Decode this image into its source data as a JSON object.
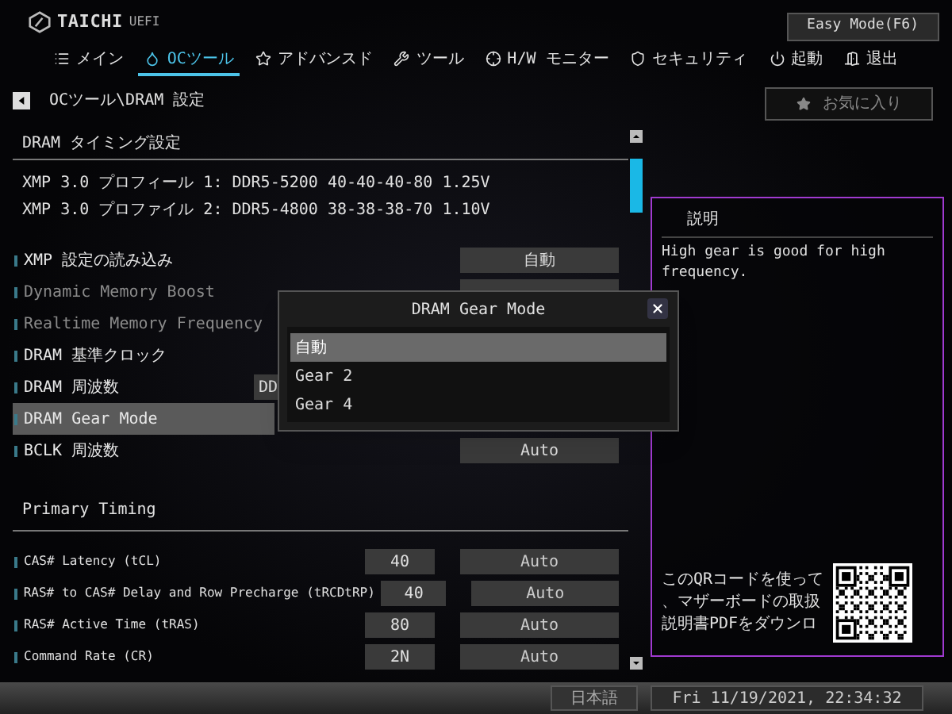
{
  "header": {
    "logo": "TAICHI",
    "logo_sub": "UEFI",
    "mode_button": "Easy Mode(F6)"
  },
  "tabs": [
    {
      "label": "メイン",
      "selected": false
    },
    {
      "label": "OCツール",
      "selected": true
    },
    {
      "label": "アドバンスド",
      "selected": false
    },
    {
      "label": "ツール",
      "selected": false
    },
    {
      "label": "H/W モニター",
      "selected": false
    },
    {
      "label": "セキュリティ",
      "selected": false
    },
    {
      "label": "起動",
      "selected": false
    },
    {
      "label": "退出",
      "selected": false
    }
  ],
  "breadcrumb": "OCツール\\DRAM 設定",
  "favorites_button": "お気に入り",
  "timing": {
    "title": "DRAM タイミング設定",
    "profiles": [
      "XMP 3.0 プロフィール 1: DDR5-5200 40-40-40-80 1.25V",
      "XMP 3.0 プロファイル 2: DDR5-4800 38-38-38-70 1.10V"
    ]
  },
  "settings": [
    {
      "label": "XMP 設定の読み込み",
      "disabled": false,
      "selected": false,
      "kind": "option",
      "value": "自動"
    },
    {
      "label": "Dynamic Memory Boost",
      "disabled": true,
      "selected": false,
      "kind": "option"
    },
    {
      "label": "Realtime Memory Frequency",
      "disabled": true,
      "selected": false,
      "kind": "option"
    },
    {
      "label": "DRAM 基準クロック",
      "disabled": false,
      "selected": false,
      "kind": "plain"
    },
    {
      "label": "DRAM 周波数",
      "disabled": false,
      "selected": false,
      "kind": "wide",
      "value": "DD"
    },
    {
      "label": "DRAM Gear Mode",
      "disabled": false,
      "selected": true,
      "kind": "plain"
    },
    {
      "label": "BCLK 周波数",
      "disabled": false,
      "selected": false,
      "kind": "option",
      "value": "Auto"
    }
  ],
  "primary_timing": {
    "title": "Primary Timing",
    "rows": [
      {
        "label": "CAS# Latency (tCL)",
        "current": "40",
        "value": "Auto"
      },
      {
        "label": "RAS# to CAS# Delay and Row Precharge (tRCDtRP)",
        "current": "40",
        "value": "Auto"
      },
      {
        "label": "RAS# Active Time (tRAS)",
        "current": "80",
        "value": "Auto"
      },
      {
        "label": "Command Rate (CR)",
        "current": "2N",
        "value": "Auto"
      }
    ]
  },
  "help": {
    "title": "説明",
    "text": "High gear is good for high frequency.",
    "qr_lines": [
      "このQRコードを使って",
      "、マザーボードの取扱",
      "説明書PDFをダウンロ"
    ]
  },
  "dialog": {
    "title": "DRAM Gear Mode",
    "options": [
      {
        "label": "自動",
        "selected": true
      },
      {
        "label": "Gear 2",
        "selected": false
      },
      {
        "label": "Gear 4",
        "selected": false
      }
    ]
  },
  "status_bar": {
    "language": "日本語",
    "datetime": "Fri 11/19/2021, 22:34:32"
  }
}
